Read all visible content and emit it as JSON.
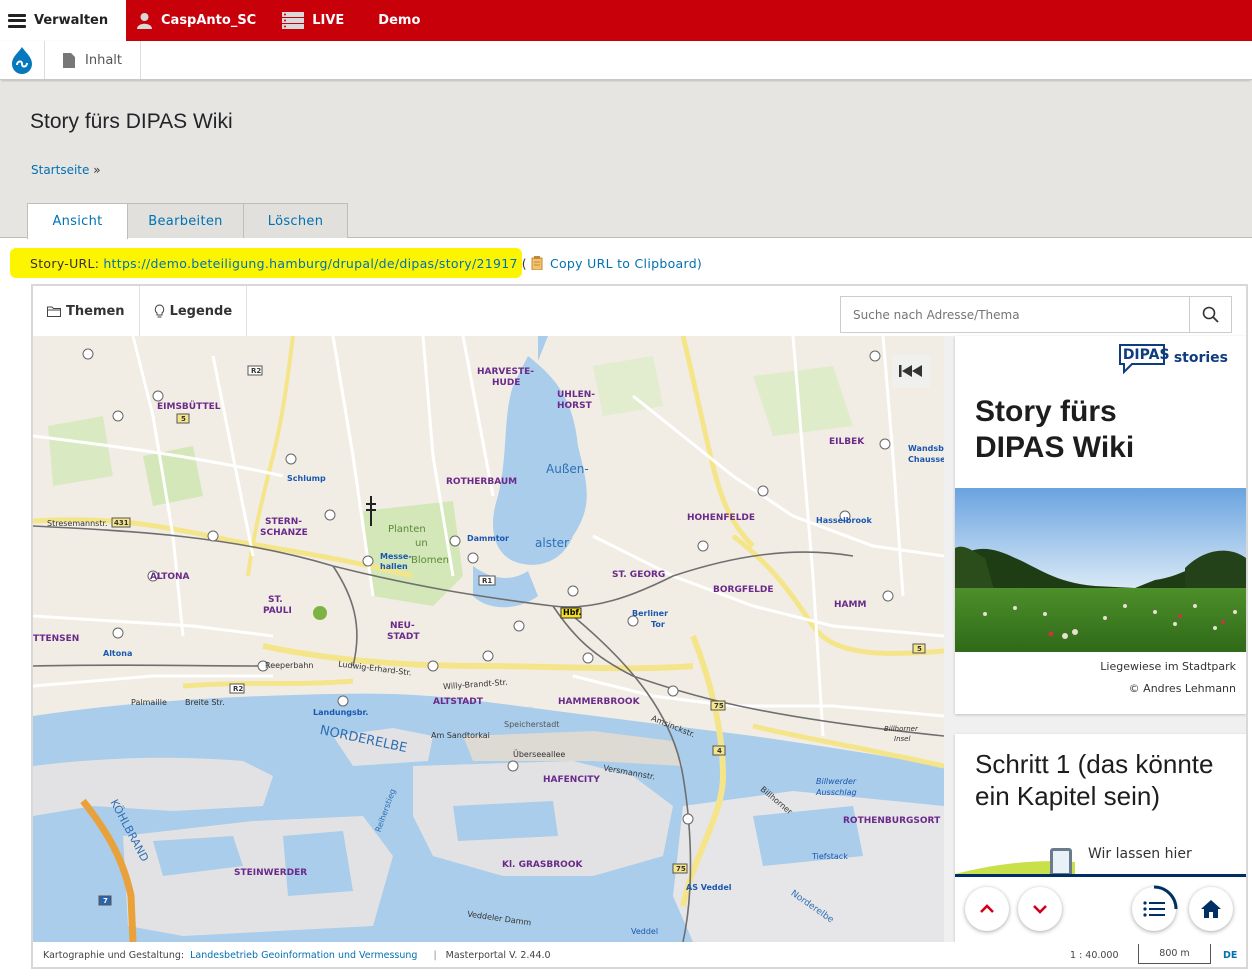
{
  "toolbar": {
    "manage_label": "Verwalten",
    "user_label": "CaspAnto_SC",
    "live_label": "LIVE",
    "demo_label": "Demo",
    "content_label": "Inhalt"
  },
  "page": {
    "title": "Story fürs DIPAS Wiki",
    "breadcrumb_home": "Startseite",
    "breadcrumb_sep": "»",
    "tabs": [
      {
        "label": "Ansicht",
        "active": true
      },
      {
        "label": "Bearbeiten",
        "active": false
      },
      {
        "label": "Löschen",
        "active": false
      }
    ]
  },
  "story_url": {
    "label": "Story-URL:",
    "url": "https://demo.beteiligung.hamburg/drupal/de/dipas/story/21917",
    "open_paren": "(",
    "copy_label": "Copy URL to Clipboard)"
  },
  "map_toolbar": {
    "themes_label": "Themen",
    "legend_label": "Legende",
    "search_placeholder": "Suche nach Adresse/Thema"
  },
  "map_labels": {
    "aussenalster_1": "Außen-",
    "aussenalster_2": "alster",
    "norderelbe": "NORDERELBE",
    "koehlbrand": "KÖHLBRAND",
    "eimsbuettel": "EIMSBÜTTEL",
    "rotherbaum": "ROTHERBAUM",
    "harvestehude_1": "HARVESTE-",
    "harvestehude_2": "HUDE",
    "uhlenhorst_1": "UHLEN-",
    "uhlenhorst_2": "HORST",
    "hohenfelde": "HOHENFELDE",
    "eilbek": "EILBEK",
    "sternschanze_1": "STERN-",
    "sternschanze_2": "SCHANZE",
    "altona": "ALTONA",
    "stpauli_1": "ST.",
    "stpauli_2": "PAULI",
    "neustadt_1": "NEU-",
    "neustadt_2": "STADT",
    "altstadt": "ALTSTADT",
    "stgeorg": "ST. GEORG",
    "borgfelde": "BORGFELDE",
    "hamm": "HAMM",
    "hammerbrook": "HAMMERBROOK",
    "hafencity": "HAFENCITY",
    "rothenburgsort": "ROTHENBURGSORT",
    "steinwerder": "STEINWERDER",
    "klgrasbrook": "Kl. GRASBROOK",
    "ottensen": "TTENSEN",
    "planten_1": "Planten",
    "planten_2": "un",
    "planten_3": "Blomen",
    "hbf": "Hbf.",
    "veddel": "Veddel",
    "asveddel": "AS Veddel",
    "norderelbe2": "Norderelbe",
    "landungsbr": "Landungsbr.",
    "dammtor": "Dammtor",
    "schlump": "Schlump",
    "messehallen_1": "Messe-",
    "messehallen_2": "hallen",
    "berliner_tor_1": "Berliner",
    "berliner_tor_2": "Tor",
    "hasselbrook": "Hasselbrook",
    "wandsbek_1": "Wandsbe",
    "wandsbek_2": "Chausse",
    "ludwig_erhard": "Ludwig-Erhard-Str.",
    "willy_brandt": "Willy-Brandt-Str.",
    "amsinckstr": "Amsinckstr.",
    "billhorner": "Billhorner",
    "reiherstieg": "Reiherstieg",
    "veddeler_damm": "Veddeler Damm",
    "speicherstadt": "Speicherstadt",
    "am_sandtorkai": "Am Sandtorkai",
    "uberseeallee": "Überseeallee",
    "versmannstr": "Versmannstr.",
    "tiefstack": "Tiefstack",
    "billwerder_1": "Billwerder",
    "billwerder_2": "Ausschlag",
    "billhorn_insel_1": "Billhorner",
    "billhorn_insel_2": "Insel",
    "stresemannstr": "Stresemannstr.",
    "reeperbahn": "Reeperbahn",
    "palmaille": "Palmaille",
    "breite_str": "Breite Str.",
    "altona_station": "Altona"
  },
  "footer": {
    "credit_label": "Kartographie und Gestaltung:",
    "credit_link": "Landesbetrieb Geoinformation und Vermessung",
    "separator": "|",
    "version": "Masterportal V. 2.44.0",
    "scale": "1 : 40.000",
    "scale_bar": "800 m",
    "language": "DE"
  },
  "story": {
    "logo_text_1": "DIPAS",
    "logo_text_2": "stories",
    "title": "Story fürs DIPAS Wiki",
    "image_caption": "Liegewiese im Stadtpark",
    "image_credit": "© Andres Lehmann",
    "step_title": "Schritt 1 (das könnte ein Kapitel sein)",
    "step_text": "Wir lassen hier"
  },
  "colors": {
    "toolbar_red": "#c8000a",
    "link_blue": "#0071b3",
    "highlight_yellow": "#fdf500",
    "water": "#a9cdea",
    "story_navy": "#003063",
    "nav_arrow_red": "#d0021b"
  }
}
